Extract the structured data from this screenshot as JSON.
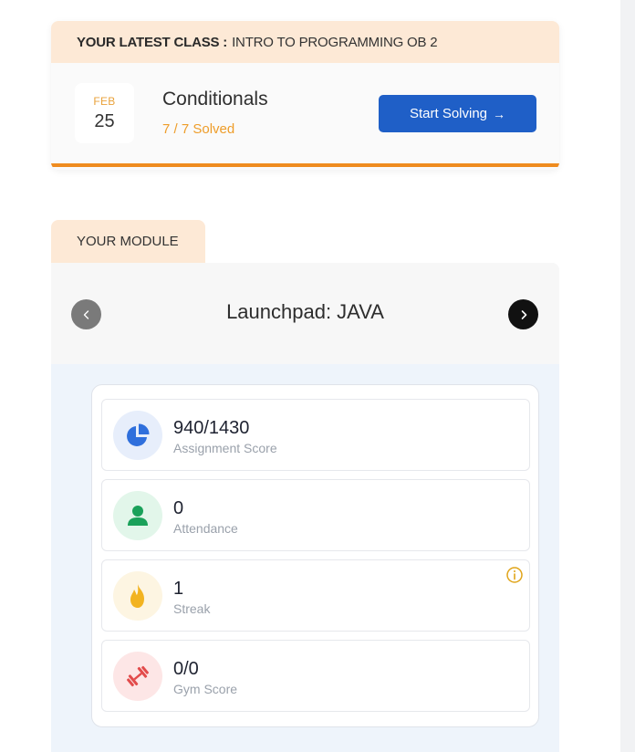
{
  "latest_class": {
    "header_label": "YOUR LATEST CLASS :",
    "header_value": "INTRO TO PROGRAMMING OB 2",
    "date_month": "FEB",
    "date_day": "25",
    "title": "Conditionals",
    "solved": "7 / 7 Solved",
    "progress": 1.0,
    "start_button": "Start Solving",
    "start_button_arrow": "→"
  },
  "module": {
    "tab_label": "YOUR MODULE",
    "name": "Launchpad: JAVA",
    "prev_icon": "chevron-left-icon",
    "next_icon": "chevron-right-icon",
    "stats": [
      {
        "value": "940/1430",
        "label": "Assignment Score",
        "icon": "pie-chart-icon",
        "icon_bg": "#e7eefb",
        "icon_color": "#2f6fdc"
      },
      {
        "value": "0",
        "label": "Attendance",
        "icon": "user-icon",
        "icon_bg": "#e2f6ea",
        "icon_color": "#1aa15a"
      },
      {
        "value": "1",
        "label": "Streak",
        "icon": "flame-icon",
        "icon_bg": "#fdf5e2",
        "icon_color": "#f2b320"
      },
      {
        "value": "0/0",
        "label": "Gym Score",
        "icon": "dumbbell-icon",
        "icon_bg": "#fde6e6",
        "icon_color": "#e24b4b"
      }
    ]
  },
  "colors": {
    "accent_orange": "#ef8c1f",
    "primary_blue": "#1f5fc7",
    "header_peach": "#fde9d6"
  }
}
